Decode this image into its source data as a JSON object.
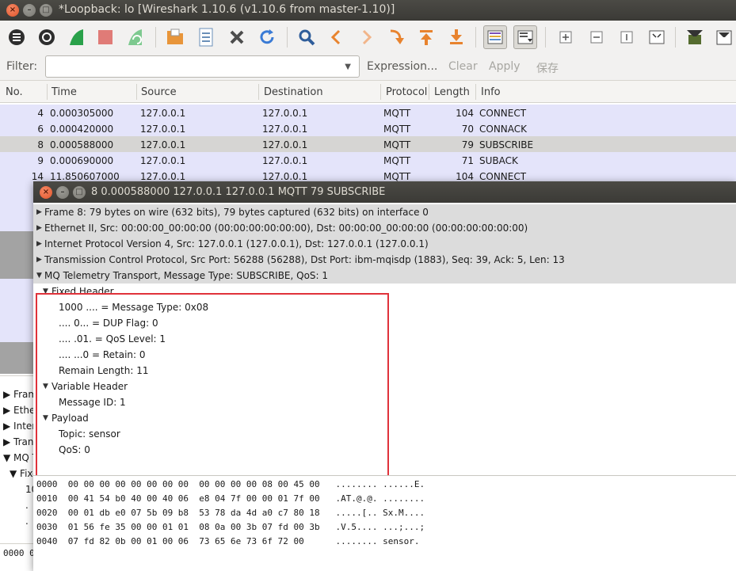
{
  "window": {
    "title": "*Loopback: lo   [Wireshark 1.10.6  (v1.10.6 from master-1.10)]"
  },
  "toolbar": {
    "icons": [
      "interfaces-icon",
      "options-icon",
      "start-capture-icon",
      "stop-capture-icon",
      "restart-capture-icon",
      "open-file-icon",
      "save-file-icon",
      "close-file-icon",
      "reload-icon",
      "find-icon",
      "go-back-icon",
      "go-forward-icon",
      "go-to-packet-icon",
      "first-packet-icon",
      "last-packet-icon",
      "colorize-icon",
      "auto-scroll-icon",
      "zoom-in-icon",
      "zoom-out-icon",
      "normal-size-icon",
      "resize-columns-icon",
      "capture-filters-icon",
      "display-filters-icon"
    ]
  },
  "filter": {
    "label": "Filter:",
    "value": "",
    "expression": "Expression...",
    "clear": "Clear",
    "apply": "Apply",
    "save": "保存"
  },
  "packet_list": {
    "columns": [
      "No.",
      "Time",
      "Source",
      "Destination",
      "Protocol",
      "Length",
      "Info"
    ],
    "rows": [
      {
        "no": "4",
        "time": "0.000305000",
        "src": "127.0.0.1",
        "dst": "127.0.0.1",
        "proto": "MQTT",
        "len": "104",
        "info": "CONNECT"
      },
      {
        "no": "6",
        "time": "0.000420000",
        "src": "127.0.0.1",
        "dst": "127.0.0.1",
        "proto": "MQTT",
        "len": "70",
        "info": "CONNACK"
      },
      {
        "no": "8",
        "time": "0.000588000",
        "src": "127.0.0.1",
        "dst": "127.0.0.1",
        "proto": "MQTT",
        "len": "79",
        "info": "SUBSCRIBE"
      },
      {
        "no": "9",
        "time": "0.000690000",
        "src": "127.0.0.1",
        "dst": "127.0.0.1",
        "proto": "MQTT",
        "len": "71",
        "info": "SUBACK"
      },
      {
        "no": "14",
        "time": "11.850607000",
        "src": "127.0.0.1",
        "dst": "127.0.0.1",
        "proto": "MQTT",
        "len": "104",
        "info": "CONNECT"
      }
    ]
  },
  "background_detail": {
    "items": [
      "Fram",
      "Ethe",
      "Inter",
      "Trans",
      "MQ T",
      "Fixe",
      "10",
      ".",
      "."
    ]
  },
  "background_hex": {
    "lines": [
      "0000  0"
    ]
  },
  "popup": {
    "title": "8 0.000588000 127.0.0.1 127.0.0.1 MQTT 79 SUBSCRIBE",
    "tree": [
      {
        "text": "Frame 8: 79 bytes on wire (632 bits), 79 bytes captured (632 bits) on interface 0"
      },
      {
        "text": "Ethernet II, Src: 00:00:00_00:00:00 (00:00:00:00:00:00), Dst: 00:00:00_00:00:00 (00:00:00:00:00:00)"
      },
      {
        "text": "Internet Protocol Version 4, Src: 127.0.0.1 (127.0.0.1), Dst: 127.0.0.1 (127.0.0.1)"
      },
      {
        "text": "Transmission Control Protocol, Src Port: 56288 (56288), Dst Port: ibm-mqisdp (1883), Seq: 39, Ack: 5, Len: 13"
      },
      {
        "text": "MQ Telemetry Transport, Message Type: SUBSCRIBE, QoS: 1"
      },
      {
        "text": "Fixed Header"
      },
      {
        "text": "1000 .... = Message Type: 0x08"
      },
      {
        "text": ".... 0... = DUP Flag: 0"
      },
      {
        "text": ".... .01. = QoS Level: 1"
      },
      {
        "text": ".... ...0 = Retain: 0"
      },
      {
        "text": "Remain Length: 11"
      },
      {
        "text": "Variable Header"
      },
      {
        "text": "Message ID: 1"
      },
      {
        "text": "Payload"
      },
      {
        "text": "Topic: sensor"
      },
      {
        "text": "QoS: 0"
      }
    ],
    "hex": [
      "0000  00 00 00 00 00 00 00 00  00 00 00 00 08 00 45 00   ........ ......E.",
      "0010  00 41 54 b0 40 00 40 06  e8 04 7f 00 00 01 7f 00   .AT.@.@. ........",
      "0020  00 01 db e0 07 5b 09 b8  53 78 da 4d a0 c7 80 18   .....[.. Sx.M....",
      "0030  01 56 fe 35 00 00 01 01  08 0a 00 3b 07 fd 00 3b   .V.5.... ...;...;",
      "0040  07 fd 82 0b 00 01 00 06  73 65 6e 73 6f 72 00      ........ sensor."
    ]
  }
}
